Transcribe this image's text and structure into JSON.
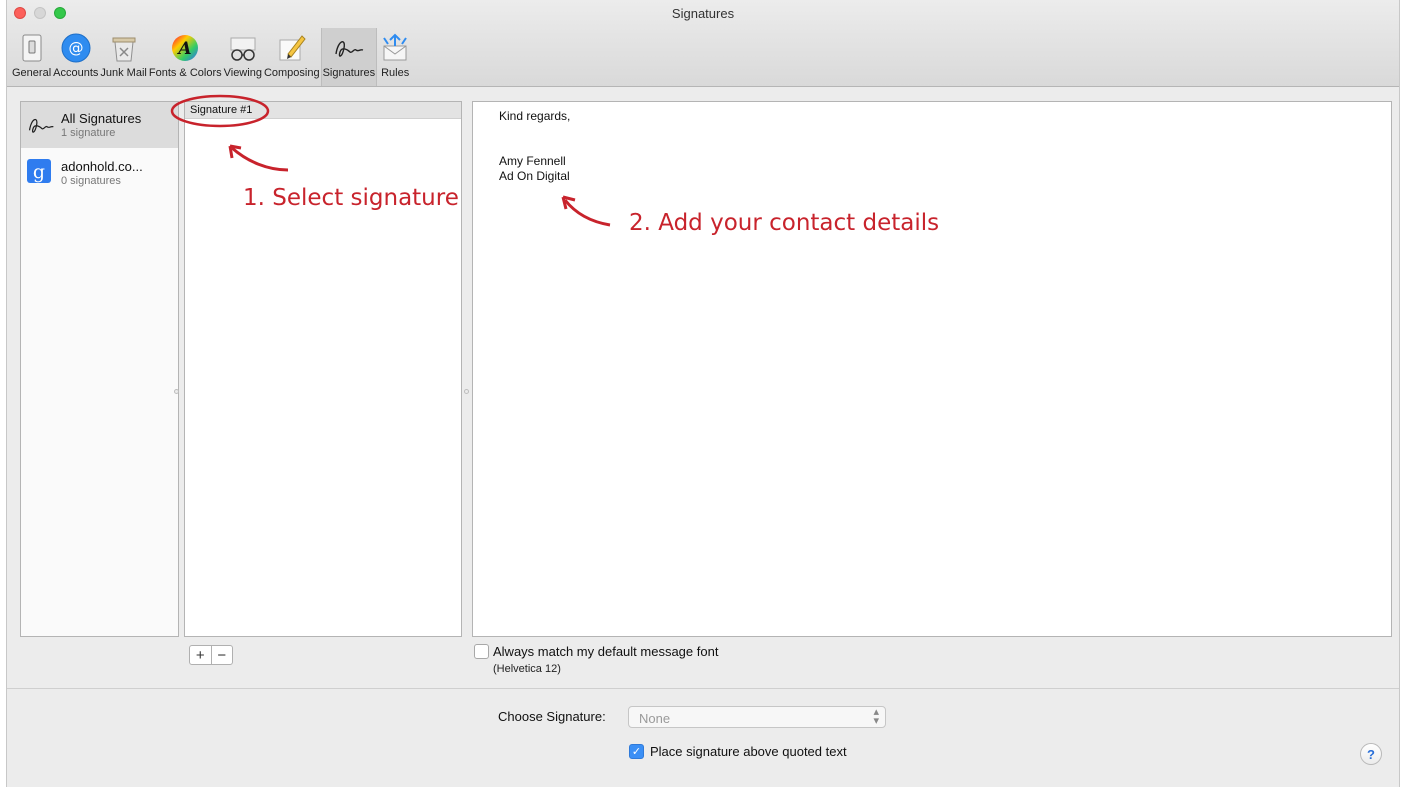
{
  "window": {
    "title": "Signatures"
  },
  "toolbar": {
    "items": [
      {
        "label": "General",
        "icon": "general-switch-icon"
      },
      {
        "label": "Accounts",
        "icon": "at-sign-icon"
      },
      {
        "label": "Junk Mail",
        "icon": "junk-bin-icon"
      },
      {
        "label": "Fonts & Colors",
        "icon": "font-color-wheel-icon"
      },
      {
        "label": "Viewing",
        "icon": "glasses-icon"
      },
      {
        "label": "Composing",
        "icon": "pencil-icon"
      },
      {
        "label": "Signatures",
        "icon": "signature-icon",
        "active": true
      },
      {
        "label": "Rules",
        "icon": "rules-envelope-icon"
      }
    ]
  },
  "accounts": [
    {
      "name": "All Signatures",
      "count": "1 signature",
      "icon": "signature-icon"
    },
    {
      "name": "adonhold.co...",
      "count": "0 signatures",
      "icon": "google-icon"
    }
  ],
  "signatures": {
    "items": [
      "Signature #1"
    ]
  },
  "editor": {
    "lines": [
      "Kind regards,",
      "Amy Fennell",
      "Ad On Digital"
    ]
  },
  "controls": {
    "add_label": "+",
    "remove_label": "−",
    "match_font_label": "Always match my default message font",
    "match_font_sub": "(Helvetica 12)",
    "choose_label": "Choose Signature:",
    "choose_value": "None",
    "place_above_label": "Place signature above quoted text",
    "help_label": "?"
  },
  "annotations": {
    "step1": "1. Select signature",
    "step2": "2. Add your contact details"
  },
  "colors": {
    "annotation": "#c8232c",
    "accent": "#3b8ff5"
  }
}
